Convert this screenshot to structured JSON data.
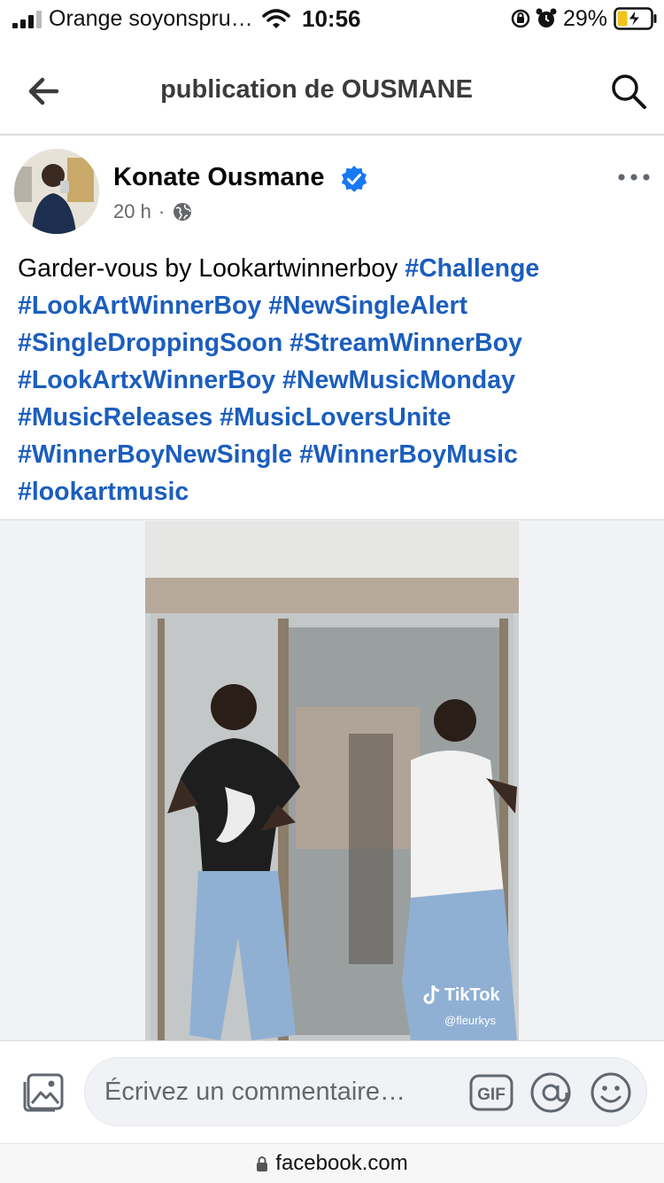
{
  "status_bar": {
    "carrier": "Orange soyonspru…",
    "time": "10:56",
    "battery": "29%"
  },
  "header": {
    "title": "publication de OUSMANE"
  },
  "post": {
    "author": "Konate Ousmane",
    "time": "20 h",
    "separator": "·",
    "text_plain": "Garder-vous by Lookartwinnerboy ",
    "hashtags": [
      "#Challenge",
      "#LookArtWinnerBoy",
      "#NewSingleAlert",
      "#SingleDroppingSoon",
      "#StreamWinnerBoy",
      "#LookArtxWinnerBoy",
      "#NewMusicMonday",
      "#MusicReleases",
      "#MusicLoversUnite",
      "#WinnerBoyNewSingle",
      "#WinnerBoyMusic",
      "#lookartmusic"
    ],
    "video": {
      "watermark": "TikTok",
      "handle": "@fleurkys"
    }
  },
  "comment_bar": {
    "placeholder": "Écrivez un commentaire…",
    "gif_label": "GIF"
  },
  "url_bar": {
    "domain": "facebook.com"
  },
  "colors": {
    "hashtag": "#1b5ebe",
    "verified": "#1877f2",
    "secondary_text": "#65676b"
  }
}
